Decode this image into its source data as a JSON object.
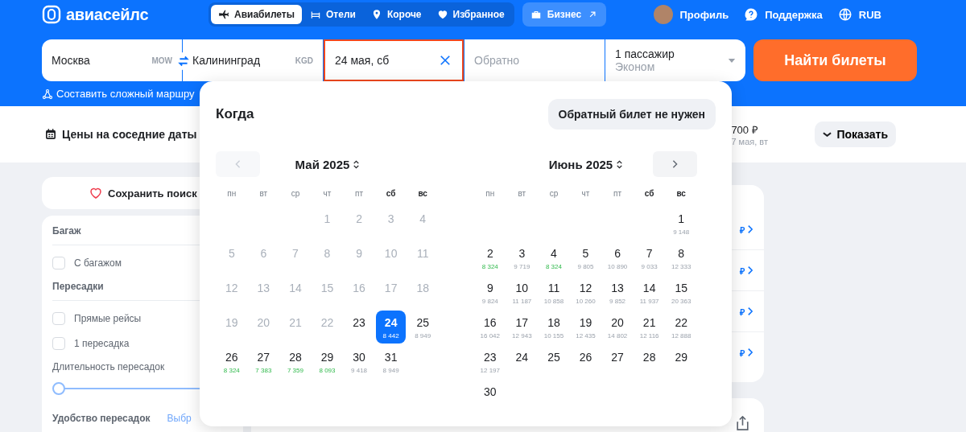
{
  "header": {
    "logo": "авиасейлс",
    "nav": [
      {
        "label": "Авиабилеты",
        "selected": true
      },
      {
        "label": "Отели",
        "selected": false
      },
      {
        "label": "Короче",
        "selected": false
      },
      {
        "label": "Избранное",
        "selected": false
      }
    ],
    "business": "Бизнес",
    "profile": "Профиль",
    "support": "Поддержка",
    "currency": "RUB"
  },
  "search": {
    "origin": {
      "city": "Москва",
      "code": "MOW"
    },
    "destination": {
      "city": "Калининград",
      "code": "KGD"
    },
    "depart": "24 мая, сб",
    "return_placeholder": "Обратно",
    "passengers": "1 пассажир",
    "cabin": "Эконом",
    "submit": "Найти билеты",
    "complex_route": "Составить сложный маршру"
  },
  "strip": {
    "nearby_dates": "Цены на соседние даты",
    "price": "700 ₽",
    "price_date": "7 мая, вт",
    "show": "Показать"
  },
  "sidebar": {
    "save": "Сохранить поиск",
    "sections": [
      {
        "title": "Багаж",
        "options": [
          {
            "label": "С багажом",
            "checked": false
          }
        ]
      },
      {
        "title": "Пересадки",
        "options": [
          {
            "label": "Прямые рейсы",
            "checked": false
          },
          {
            "label": "1 пересадка",
            "checked": false
          }
        ]
      }
    ],
    "duration": {
      "label": "Длительность пересадок",
      "level": 0
    },
    "comfort": {
      "label": "Удобство пересадок",
      "link": "Выбр"
    }
  },
  "results": {
    "prices": [
      "₽",
      "₽",
      "₽",
      "₽"
    ]
  },
  "calendar": {
    "title": "Когда",
    "no_return": "Обратный билет не нужен",
    "months": [
      {
        "title": "Май 2025",
        "nav_disabled": true,
        "weekdays": [
          {
            "label": "пн",
            "weekend": false
          },
          {
            "label": "вт",
            "weekend": false
          },
          {
            "label": "ср",
            "weekend": false
          },
          {
            "label": "чт",
            "weekend": false
          },
          {
            "label": "пт",
            "weekend": false
          },
          {
            "label": "сб",
            "weekend": true
          },
          {
            "label": "вс",
            "weekend": true
          }
        ],
        "weeks": [
          [
            {
              "day": "1",
              "disabled": true,
              "selected": false
            },
            {
              "day": "2",
              "disabled": true,
              "selected": false
            },
            {
              "day": "3",
              "disabled": true,
              "selected": false
            },
            {
              "day": "4",
              "disabled": true,
              "selected": false
            }
          ],
          [
            {
              "day": "5",
              "disabled": true,
              "selected": false
            },
            {
              "day": "6",
              "disabled": true,
              "selected": false
            },
            {
              "day": "7",
              "disabled": true,
              "selected": false
            },
            {
              "day": "8",
              "disabled": true,
              "selected": false
            },
            {
              "day": "9",
              "disabled": true,
              "selected": false
            },
            {
              "day": "10",
              "disabled": true,
              "selected": false
            },
            {
              "day": "11",
              "disabled": true,
              "selected": false
            }
          ],
          [
            {
              "day": "12",
              "disabled": true,
              "selected": false
            },
            {
              "day": "13",
              "disabled": true,
              "selected": false
            },
            {
              "day": "14",
              "disabled": true,
              "selected": false
            },
            {
              "day": "15",
              "disabled": true,
              "selected": false
            },
            {
              "day": "16",
              "disabled": true,
              "selected": false
            },
            {
              "day": "17",
              "disabled": true,
              "selected": false
            },
            {
              "day": "18",
              "disabled": true,
              "selected": false
            }
          ],
          [
            {
              "day": "19",
              "disabled": true,
              "selected": false
            },
            {
              "day": "20",
              "disabled": true,
              "selected": false
            },
            {
              "day": "21",
              "disabled": true,
              "selected": false
            },
            {
              "day": "22",
              "disabled": true,
              "selected": false
            },
            {
              "day": "23",
              "disabled": false,
              "selected": false
            },
            {
              "day": "24",
              "disabled": false,
              "selected": true,
              "price": "8 442",
              "cheap": false
            },
            {
              "day": "25",
              "disabled": false,
              "selected": false,
              "price": "8 949",
              "cheap": false
            }
          ],
          [
            {
              "day": "26",
              "disabled": false,
              "selected": false,
              "price": "8 324",
              "cheap": true
            },
            {
              "day": "27",
              "disabled": false,
              "selected": false,
              "price": "7 383",
              "cheap": true
            },
            {
              "day": "28",
              "disabled": false,
              "selected": false,
              "price": "7 359",
              "cheap": true
            },
            {
              "day": "29",
              "disabled": false,
              "selected": false,
              "price": "8 093",
              "cheap": true
            },
            {
              "day": "30",
              "disabled": false,
              "selected": false,
              "price": "9 418",
              "cheap": false
            },
            {
              "day": "31",
              "disabled": false,
              "selected": false,
              "price": "8 949",
              "cheap": false
            }
          ]
        ]
      },
      {
        "title": "Июнь 2025",
        "nav_disabled": false,
        "weekdays": [
          {
            "label": "пн",
            "weekend": false
          },
          {
            "label": "вт",
            "weekend": false
          },
          {
            "label": "ср",
            "weekend": false
          },
          {
            "label": "чт",
            "weekend": false
          },
          {
            "label": "пт",
            "weekend": false
          },
          {
            "label": "сб",
            "weekend": true
          },
          {
            "label": "вс",
            "weekend": true
          }
        ],
        "weeks": [
          [
            {
              "day": "1",
              "disabled": false,
              "selected": false,
              "price": "9 148",
              "cheap": false
            }
          ],
          [
            {
              "day": "2",
              "disabled": false,
              "selected": false,
              "price": "8 324",
              "cheap": true
            },
            {
              "day": "3",
              "disabled": false,
              "selected": false,
              "price": "9 719",
              "cheap": false
            },
            {
              "day": "4",
              "disabled": false,
              "selected": false,
              "price": "8 324",
              "cheap": true
            },
            {
              "day": "5",
              "disabled": false,
              "selected": false,
              "price": "9 805",
              "cheap": false
            },
            {
              "day": "6",
              "disabled": false,
              "selected": false,
              "price": "10 890",
              "cheap": false
            },
            {
              "day": "7",
              "disabled": false,
              "selected": false,
              "price": "9 033",
              "cheap": false
            },
            {
              "day": "8",
              "disabled": false,
              "selected": false,
              "price": "12 333",
              "cheap": false
            }
          ],
          [
            {
              "day": "9",
              "disabled": false,
              "selected": false,
              "price": "9 824",
              "cheap": false
            },
            {
              "day": "10",
              "disabled": false,
              "selected": false,
              "price": "11 187",
              "cheap": false
            },
            {
              "day": "11",
              "disabled": false,
              "selected": false,
              "price": "10 858",
              "cheap": false
            },
            {
              "day": "12",
              "disabled": false,
              "selected": false,
              "price": "10 260",
              "cheap": false
            },
            {
              "day": "13",
              "disabled": false,
              "selected": false,
              "price": "9 852",
              "cheap": false
            },
            {
              "day": "14",
              "disabled": false,
              "selected": false,
              "price": "11 937",
              "cheap": false
            },
            {
              "day": "15",
              "disabled": false,
              "selected": false,
              "price": "20 363",
              "cheap": false
            }
          ],
          [
            {
              "day": "16",
              "disabled": false,
              "selected": false,
              "price": "16 042",
              "cheap": false
            },
            {
              "day": "17",
              "disabled": false,
              "selected": false,
              "price": "12 943",
              "cheap": false
            },
            {
              "day": "18",
              "disabled": false,
              "selected": false,
              "price": "10 155",
              "cheap": false
            },
            {
              "day": "19",
              "disabled": false,
              "selected": false,
              "price": "12 435",
              "cheap": false
            },
            {
              "day": "20",
              "disabled": false,
              "selected": false,
              "price": "14 802",
              "cheap": false
            },
            {
              "day": "21",
              "disabled": false,
              "selected": false,
              "price": "12 116",
              "cheap": false
            },
            {
              "day": "22",
              "disabled": false,
              "selected": false,
              "price": "12 888",
              "cheap": false
            }
          ],
          [
            {
              "day": "23",
              "disabled": false,
              "selected": false,
              "price": "12 197",
              "cheap": false
            },
            {
              "day": "24",
              "disabled": false,
              "selected": false
            },
            {
              "day": "25",
              "disabled": false,
              "selected": false
            },
            {
              "day": "26",
              "disabled": false,
              "selected": false
            },
            {
              "day": "27",
              "disabled": false,
              "selected": false
            },
            {
              "day": "28",
              "disabled": false,
              "selected": false
            },
            {
              "day": "29",
              "disabled": false,
              "selected": false
            }
          ],
          [
            {
              "day": "30",
              "disabled": false,
              "selected": false
            }
          ]
        ]
      }
    ]
  }
}
